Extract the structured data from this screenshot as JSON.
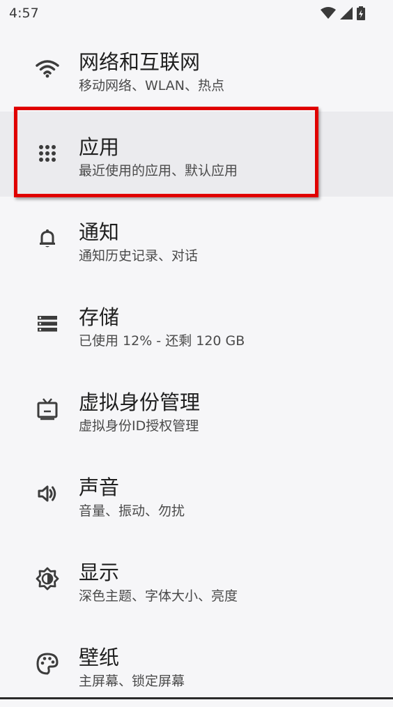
{
  "status_bar": {
    "time": "4:57",
    "icons": [
      "wifi-icon",
      "cellular-signal-icon",
      "battery-charging-icon"
    ]
  },
  "settings": {
    "items": [
      {
        "title": "网络和互联网",
        "subtitle": "移动网络、WLAN、热点",
        "icon": "wifi-icon"
      },
      {
        "title": "应用",
        "subtitle": "最近使用的应用、默认应用",
        "icon": "apps-grid-icon",
        "highlighted": true
      },
      {
        "title": "通知",
        "subtitle": "通知历史记录、对话",
        "icon": "bell-icon"
      },
      {
        "title": "存储",
        "subtitle": "已使用 12% - 还剩 120 GB",
        "icon": "storage-icon"
      },
      {
        "title": "虚拟身份管理",
        "subtitle": "虚拟身份ID授权管理",
        "icon": "tv-icon"
      },
      {
        "title": "声音",
        "subtitle": "音量、振动、勿扰",
        "icon": "volume-icon"
      },
      {
        "title": "显示",
        "subtitle": "深色主题、字体大小、亮度",
        "icon": "brightness-icon"
      },
      {
        "title": "壁纸",
        "subtitle": "主屏幕、锁定屏幕",
        "icon": "palette-icon"
      }
    ]
  },
  "colors": {
    "background": "#f6f6f8",
    "highlight": "#ebebee",
    "focus_border": "#e00000",
    "icon": "#3c3c3c"
  }
}
